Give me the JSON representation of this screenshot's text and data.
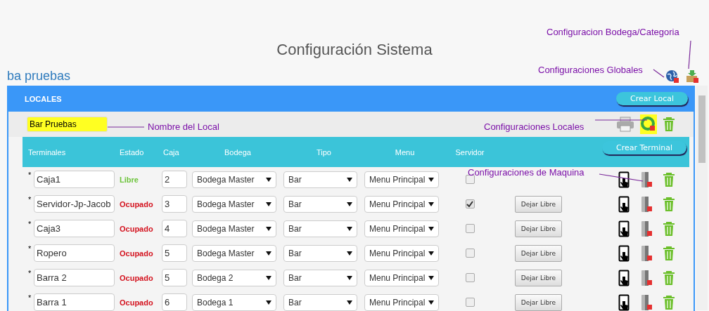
{
  "page_title": "Configuración Sistema",
  "account": "ba pruebas",
  "annotations": {
    "bodega_categoria": "Configuracion Bodega/Categoria",
    "globales": "Configuraciones Globales",
    "nombre_local": "Nombre del Local",
    "locales": "Configuraciones Locales",
    "maquina": "Configuraciones de Maquina"
  },
  "panel": {
    "title": "LOCALES",
    "create_button": "Crear Local"
  },
  "local": {
    "name": "Bar Pruebas",
    "highlighted": true,
    "config_highlighted": true
  },
  "table": {
    "columns": [
      "Terminales",
      "Estado",
      "Caja",
      "Bodega",
      "Tipo",
      "Menu",
      "Servidor"
    ],
    "create_button": "Crear Terminal",
    "rows": [
      {
        "required": "*",
        "terminal": "Caja1",
        "estado": "Libre",
        "free": true,
        "caja": "2",
        "bodega": "Bodega Master",
        "tipo": "Bar",
        "menu": "Menu Principal",
        "servidor": false
      },
      {
        "required": "*",
        "terminal": "Servidor-Jp-Jacob",
        "estado": "Ocupado",
        "free": false,
        "caja": "3",
        "bodega": "Bodega Master",
        "tipo": "Bar",
        "menu": "Menu Principal",
        "servidor": true,
        "release_button": "Dejar Libre"
      },
      {
        "required": "*",
        "terminal": "Caja3",
        "estado": "Ocupado",
        "free": false,
        "caja": "4",
        "bodega": "Bodega Master",
        "tipo": "Bar",
        "menu": "Menu Principal",
        "servidor": false,
        "release_button": "Dejar Libre"
      },
      {
        "required": "*",
        "terminal": "Ropero",
        "estado": "Ocupado",
        "free": false,
        "caja": "5",
        "bodega": "Bodega Master",
        "tipo": "Bar",
        "menu": "Menu Principal",
        "servidor": false,
        "release_button": "Dejar Libre"
      },
      {
        "required": "*",
        "terminal": "Barra 2",
        "estado": "Ocupado",
        "free": false,
        "caja": "5",
        "bodega": "Bodega 2",
        "tipo": "Bar",
        "menu": "Menu Principal",
        "servidor": false,
        "release_button": "Dejar Libre"
      },
      {
        "required": "*",
        "terminal": "Barra 1",
        "estado": "Ocupado",
        "free": false,
        "caja": "6",
        "bodega": "Bodega 1",
        "tipo": "Bar",
        "menu": "Menu Principal",
        "servidor": false,
        "release_button": "Dejar Libre"
      }
    ]
  }
}
